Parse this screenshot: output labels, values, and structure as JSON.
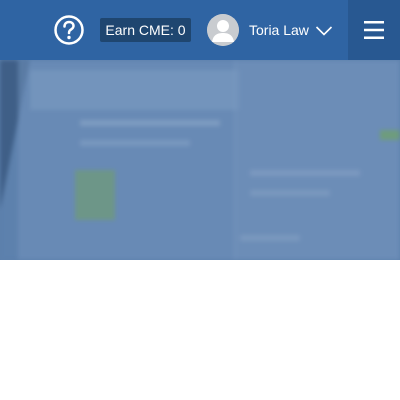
{
  "header": {
    "help_icon": "question-circle-icon",
    "earn_cme_label": "Earn CME: 0",
    "user": {
      "name": "Toria Law",
      "avatar_icon": "user-avatar-icon"
    },
    "dropdown_icon": "chevron-down-icon",
    "menu_icon": "hamburger-menu-icon"
  },
  "colors": {
    "header_bg": "#2f64a3",
    "badge_bg": "#1f4670",
    "menu_bg": "#285891",
    "hero_overlay": "#5b7fab"
  }
}
